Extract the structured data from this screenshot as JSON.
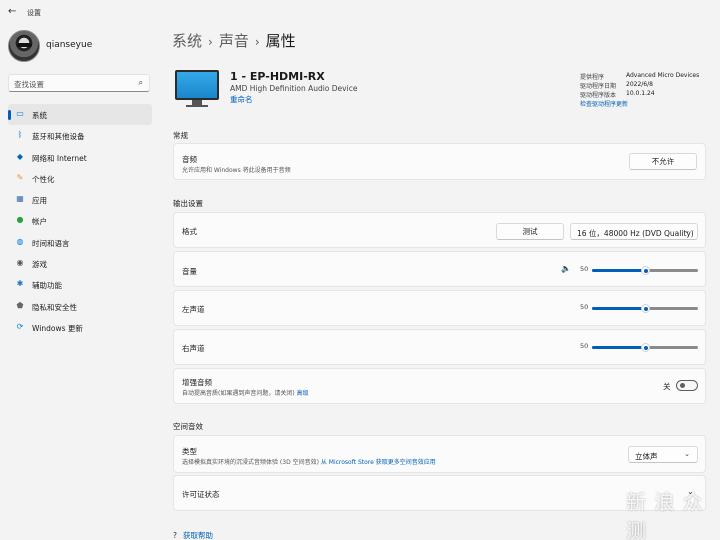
{
  "window": {
    "back_icon": "back-arrow-icon",
    "title": "设置"
  },
  "profile": {
    "username": "qianseyue"
  },
  "search": {
    "placeholder": "查找设置",
    "icon": "search-icon"
  },
  "nav": [
    {
      "label": "系统",
      "icon": "monitor-icon",
      "color": "#0078d4",
      "selected": true
    },
    {
      "label": "蓝牙和其他设备",
      "icon": "bluetooth-icon",
      "color": "#0078d4"
    },
    {
      "label": "网络和 Internet",
      "icon": "wifi-icon",
      "color": "#0067c0"
    },
    {
      "label": "个性化",
      "icon": "brush-icon",
      "color": "#e8912d"
    },
    {
      "label": "应用",
      "icon": "apps-icon",
      "color": "#3a6ea5"
    },
    {
      "label": "帐户",
      "icon": "account-icon",
      "color": "#2ea043"
    },
    {
      "label": "时间和语言",
      "icon": "globe-clock-icon",
      "color": "#0078d4"
    },
    {
      "label": "游戏",
      "icon": "gamepad-icon",
      "color": "#555555"
    },
    {
      "label": "辅助功能",
      "icon": "accessibility-icon",
      "color": "#1a73c8"
    },
    {
      "label": "隐私和安全性",
      "icon": "shield-icon",
      "color": "#666666"
    },
    {
      "label": "Windows 更新",
      "icon": "update-icon",
      "color": "#0078d4"
    }
  ],
  "breadcrumb": {
    "items": [
      "系统",
      "声音"
    ],
    "current": "属性"
  },
  "device": {
    "name": "1 - EP-HDMI-RX",
    "description": "AMD High Definition Audio Device",
    "rename_link": "重命名",
    "driver": {
      "provider_label": "提供程序",
      "provider": "Advanced Micro Devices",
      "date_label": "驱动程序日期",
      "date": "2022/6/8",
      "version_label": "驱动程序版本",
      "version": "10.0.1.24",
      "update_link": "检查驱动程序更新"
    }
  },
  "general": {
    "title": "常规",
    "audio": {
      "label": "音频",
      "sub": "允许应用和 Windows 将此设备用于音频",
      "button": "不允许"
    }
  },
  "output": {
    "title": "输出设置",
    "format": {
      "label": "格式",
      "test_button": "测试",
      "value": "16 位，48000 Hz (DVD Quality)"
    },
    "volume": {
      "label": "音量",
      "value": "50",
      "level": 0.5
    },
    "left": {
      "label": "左声道",
      "value": "50",
      "level": 0.5
    },
    "right": {
      "label": "右声道",
      "value": "50",
      "level": 0.5
    },
    "enhance": {
      "label": "增强音频",
      "sub": "自动提高音质(如果遇到声音问题，请关闭)",
      "sub_link": "高级",
      "toggle_label": "关",
      "on": false
    }
  },
  "spatial": {
    "title": "空间音效",
    "type": {
      "label": "类型",
      "sub": "选择模拟真实环境的沉浸式音频体验 (3D 空间音效)",
      "sub_link": "从 Microsoft Store 获取更多空间音效应用",
      "value": "立体声"
    },
    "license": {
      "label": "许可证状态"
    }
  },
  "help": {
    "label": "获取帮助"
  },
  "watermark": {
    "text": "新 浪 众 测"
  },
  "colors": {
    "accent": "#005fb8",
    "background": "#f3f3f3",
    "card": "#fbfbfb"
  }
}
